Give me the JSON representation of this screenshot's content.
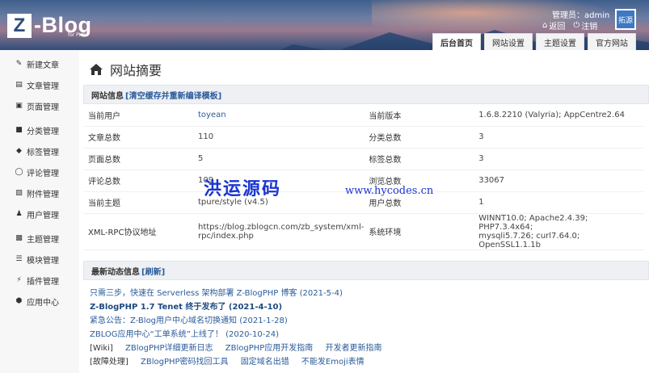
{
  "header": {
    "logo_letter": "Z",
    "logo_text": "-Blog",
    "logo_sub": "for PHP",
    "admin_label": "管理员：admin",
    "back_label": "返回",
    "logout_label": "注销",
    "avatar_label": "拓源",
    "tabs": [
      {
        "label": "后台首页",
        "active": true
      },
      {
        "label": "网站设置",
        "active": false
      },
      {
        "label": "主题设置",
        "active": false
      },
      {
        "label": "官方网站",
        "active": false
      }
    ]
  },
  "sidebar": {
    "items": [
      {
        "label": "新建文章",
        "icon": "edit-icon"
      },
      {
        "label": "文章管理",
        "icon": "document-icon"
      },
      {
        "label": "页面管理",
        "icon": "page-icon"
      },
      {
        "label": "分类管理",
        "icon": "folder-icon"
      },
      {
        "label": "标签管理",
        "icon": "tag-icon"
      },
      {
        "label": "评论管理",
        "icon": "comment-icon"
      },
      {
        "label": "附件管理",
        "icon": "attachment-icon"
      },
      {
        "label": "用户管理",
        "icon": "user-icon"
      },
      {
        "label": "主题管理",
        "icon": "theme-icon"
      },
      {
        "label": "模块管理",
        "icon": "module-icon"
      },
      {
        "label": "插件管理",
        "icon": "plugin-icon"
      },
      {
        "label": "应用中心",
        "icon": "app-center-icon"
      }
    ]
  },
  "main": {
    "title": "网站摘要",
    "site_info": {
      "heading": "网站信息",
      "clear_cache_link": "[清空缓存并重新编译模板]",
      "rows": [
        {
          "k1": "当前用户",
          "v1": "toyean",
          "k2": "当前版本",
          "v2": "1.6.8.2210 (Valyria); AppCentre2.64"
        },
        {
          "k1": "文章总数",
          "v1": "110",
          "k2": "分类总数",
          "v2": "3"
        },
        {
          "k1": "页面总数",
          "v1": "5",
          "k2": "标签总数",
          "v2": "3"
        },
        {
          "k1": "评论总数",
          "v1": "109",
          "k2": "浏览总数",
          "v2": "33067"
        },
        {
          "k1": "当前主题",
          "v1": "tpure/style (v4.5)",
          "k2": "用户总数",
          "v2": "1"
        },
        {
          "k1": "XML-RPC协议地址",
          "v1a": "https://blog.zblogcn.com/zb_system/xml-",
          "v1b": "rpc/index.php",
          "k2": "系统环境",
          "v2a": "WINNT10.0; Apache2.4.39; PHP7.3.4x64;",
          "v2b": "mysqli5.7.26; curl7.64.0; OpenSSL1.1.1b"
        }
      ]
    },
    "news": {
      "heading": "最新动态信息",
      "refresh_link": "[刷新]",
      "items": [
        "只需三步，快速在 Serverless 架构部署 Z-BlogPHP 博客 (2021-5-4)",
        "Z-BlogPHP 1.7 Tenet 终于发布了 (2021-4-10)",
        "紧急公告：Z-Blog用户中心域名切换通知 (2021-1-28)",
        "ZBLOG应用中心“工单系统”上线了！ (2020-10-24)"
      ],
      "wiki_prefix": "[Wiki]",
      "wiki_links": [
        "ZBlogPHP详细更新日志",
        "ZBlogPHP应用开发指南",
        "开发者更新指南"
      ],
      "fix_prefix": "[故障处理]",
      "fix_links": [
        "ZBlogPHP密码找回工具",
        "固定域名出错",
        "不能发Emoji表情"
      ]
    }
  },
  "watermark": {
    "text": "洪运源码",
    "url": "www.hycodes.cn"
  },
  "colors": {
    "accent": "#2a5b9b",
    "header": "#2e4d7a",
    "watermark": "#1a35d1"
  }
}
